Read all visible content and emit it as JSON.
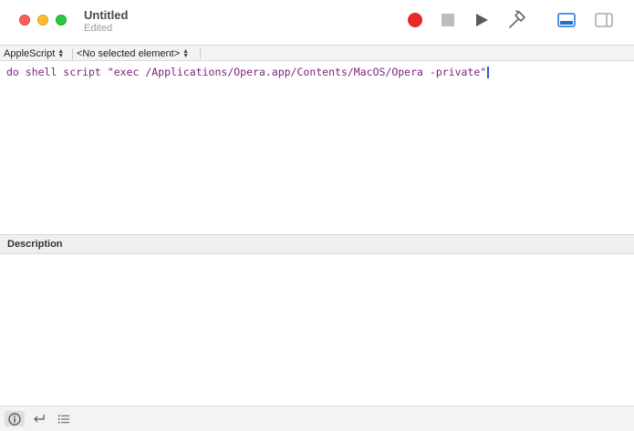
{
  "window": {
    "title": "Untitled",
    "subtitle": "Edited"
  },
  "toolbar": {
    "record_icon": "record-icon",
    "stop_icon": "stop-icon",
    "run_icon": "play-icon",
    "compile_icon": "hammer-icon",
    "colors": {
      "record": "#e8282b",
      "stop": "#bcbcbc",
      "run": "#5a5a5a",
      "accent": "#1f6fd1"
    }
  },
  "navbar": {
    "language": "AppleScript",
    "element": "<No selected element>"
  },
  "editor": {
    "code": "do shell script \"exec /Applications/Opera.app/Contents/MacOS/Opera -private\""
  },
  "description": {
    "header": "Description"
  },
  "bottombar": {
    "icons": [
      "info-icon",
      "reply-arrow-icon",
      "list-icon"
    ]
  }
}
